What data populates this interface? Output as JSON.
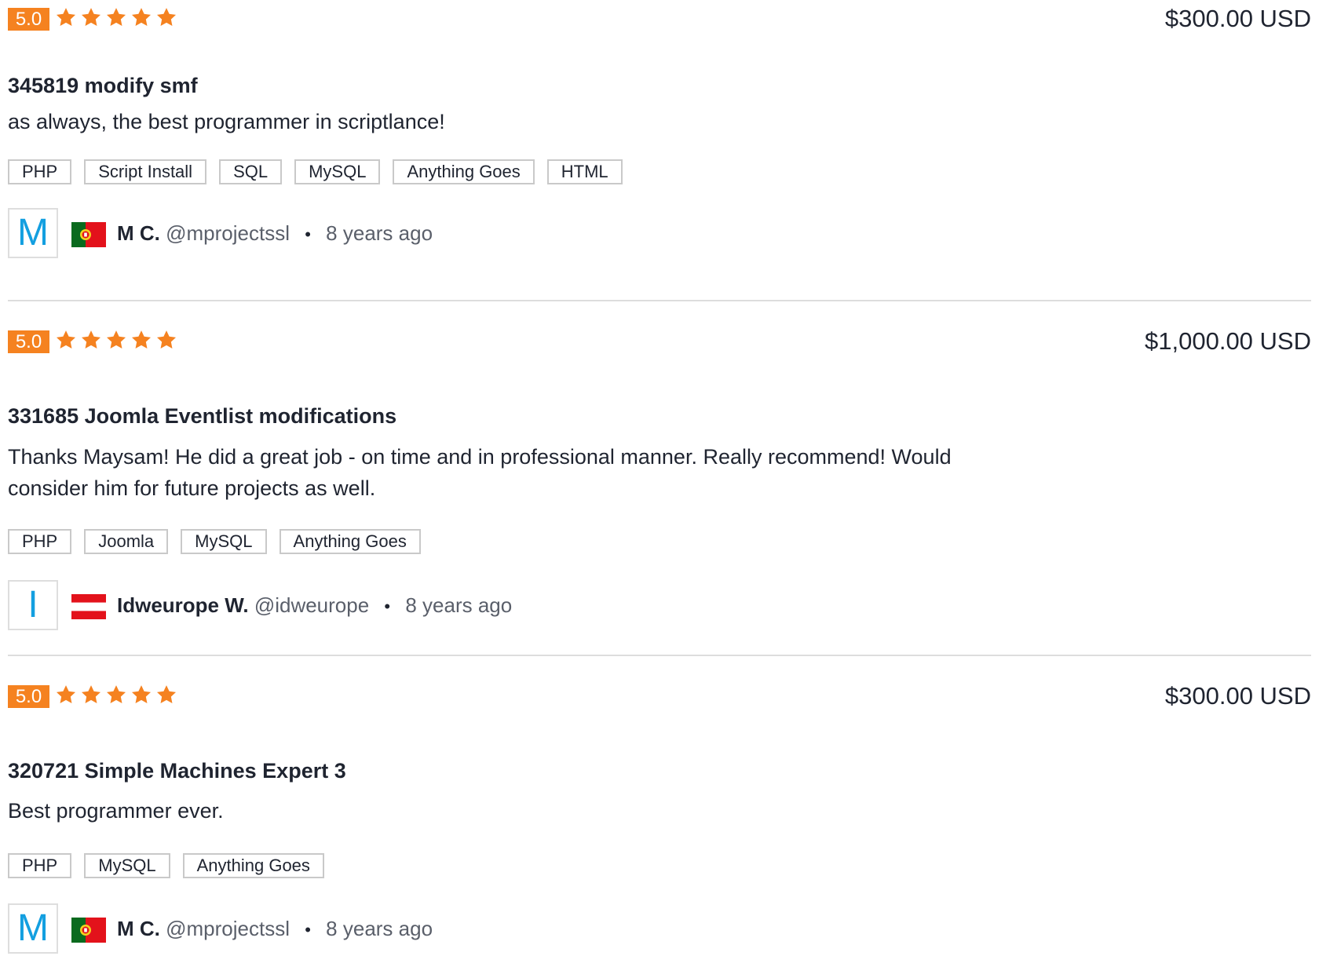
{
  "colors": {
    "rating_badge": "#f58220",
    "star": "#f58220",
    "avatar_letter": "#139fe0",
    "tag_border": "#c9c9c9",
    "divider": "#dddddd"
  },
  "reviews": [
    {
      "rating": "5.0",
      "stars_filled": 5,
      "stars_total": 5,
      "price": "$300.00 USD",
      "title": "345819 modify smf",
      "comment": "as always, the best programmer in scriptlance!",
      "tags": [
        "PHP",
        "Script Install",
        "SQL",
        "MySQL",
        "Anything Goes",
        "HTML"
      ],
      "author": {
        "avatar_letter": "M",
        "flag": "portugal-flag-icon",
        "name": "M C.",
        "username": "@mprojectssl",
        "separator": "•",
        "time": "8 years ago"
      }
    },
    {
      "rating": "5.0",
      "stars_filled": 5,
      "stars_total": 5,
      "price": "$1,000.00 USD",
      "title": "331685 Joomla Eventlist modifications",
      "comment": "Thanks Maysam! He did a great job - on time and in professional manner. Really recommend! Would consider him for future projects as well.",
      "tags": [
        "PHP",
        "Joomla",
        "MySQL",
        "Anything Goes"
      ],
      "author": {
        "avatar_letter": "I",
        "flag": "austria-flag-icon",
        "name": "Idweurope W.",
        "username": "@idweurope",
        "separator": "•",
        "time": "8 years ago"
      }
    },
    {
      "rating": "5.0",
      "stars_filled": 5,
      "stars_total": 5,
      "price": "$300.00 USD",
      "title": "320721 Simple Machines Expert 3",
      "comment": "Best programmer ever.",
      "tags": [
        "PHP",
        "MySQL",
        "Anything Goes"
      ],
      "author": {
        "avatar_letter": "M",
        "flag": "portugal-flag-icon",
        "name": "M C.",
        "username": "@mprojectssl",
        "separator": "•",
        "time": "8 years ago"
      }
    }
  ]
}
